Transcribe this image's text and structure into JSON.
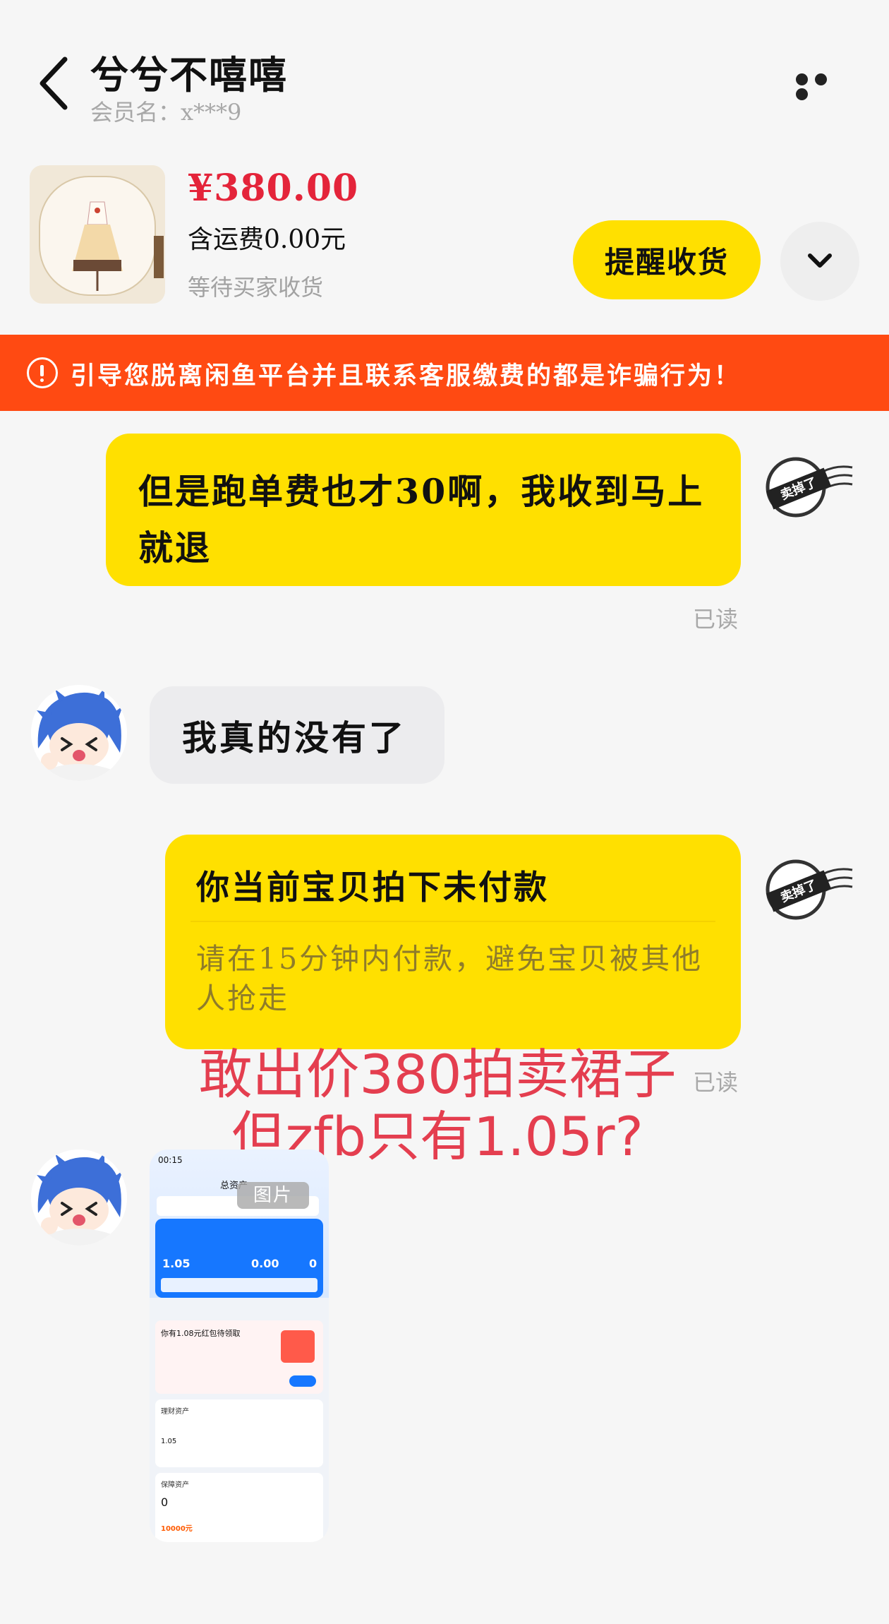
{
  "header": {
    "title": "兮兮不嘻嘻",
    "member_label": "会员名：x***9"
  },
  "product": {
    "price": "¥380.00",
    "shipping": "含运费0.00元",
    "status": "等待买家收货",
    "remind_button": "提醒收货"
  },
  "warning": {
    "text": "引导您脱离闲鱼平台并且联系客服缴费的都是诈骗行为！"
  },
  "messages": [
    {
      "text": "但是跑单费也才30啊，我收到马上就退",
      "read": "已读"
    },
    {
      "text": "我真的没有了"
    },
    {
      "card_title": "你当前宝贝拍下未付款",
      "card_body": "请在15分钟内付款，避免宝贝被其他人抢走",
      "read": "已读"
    }
  ],
  "overlay": {
    "line1": "敢出价380拍卖裙子",
    "line2": "但zfb只有1.05r?"
  },
  "image_message": {
    "tag": "图片",
    "status_time": "00:15",
    "app_title": "总资产",
    "balance": "1.05",
    "yesterday": "0.00",
    "protect": "0",
    "promo": "你有1.08元红包待领取",
    "asset_label": "理财资产",
    "asset_value": "1.05",
    "insurance_label": "保障资产",
    "insurance_count": "0",
    "insurance_amount": "10000元"
  },
  "colors": {
    "accent_yellow": "#ffe000",
    "warning_orange": "#ff4a12",
    "price_red": "#e4243a",
    "overlay_red": "#e43e4f"
  },
  "icons": [
    "back-icon",
    "more-icon",
    "chevron-down-icon",
    "warning-icon",
    "sold-stamp-icon"
  ]
}
